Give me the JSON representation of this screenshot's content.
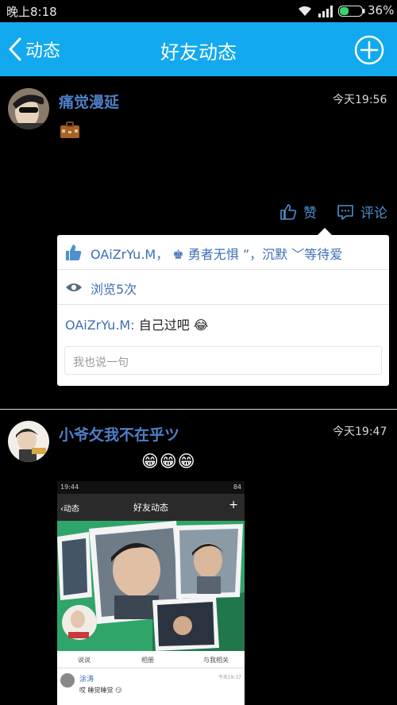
{
  "status_bar": {
    "time": "晚上8:18",
    "battery": "36%"
  },
  "title_bar": {
    "back_label": "动态",
    "title": "好友动态"
  },
  "posts": [
    {
      "username": "痛觉漫延",
      "time": "今天19:56",
      "like_label": "赞",
      "comment_label": "评论",
      "likes_text": "OAiZrYu.M， ♚ 勇者无惧 ”，沉默 ﹀等待爱",
      "views_text": "浏览5次",
      "comment_author": "OAiZrYu.M:",
      "comment_text": " 自己过吧 😂",
      "reply_placeholder": "我也说一句"
    },
    {
      "username": "小爷攵我不在乎ツ",
      "time": "今天19:47",
      "content": "😁😁😁",
      "screenshot": {
        "status_time": "19:44",
        "status_right": "84",
        "back_label": "动态",
        "title": "好友动态",
        "tabs": [
          "说说",
          "相册",
          "与我相关"
        ],
        "entry_name": "涂涛",
        "entry_time": "今天19:37",
        "entry_text": "哎 睡觉睡觉 😏"
      }
    }
  ],
  "colors": {
    "accent": "#12a9ee",
    "username": "#4f7fc7",
    "link": "#4f8fd0"
  }
}
